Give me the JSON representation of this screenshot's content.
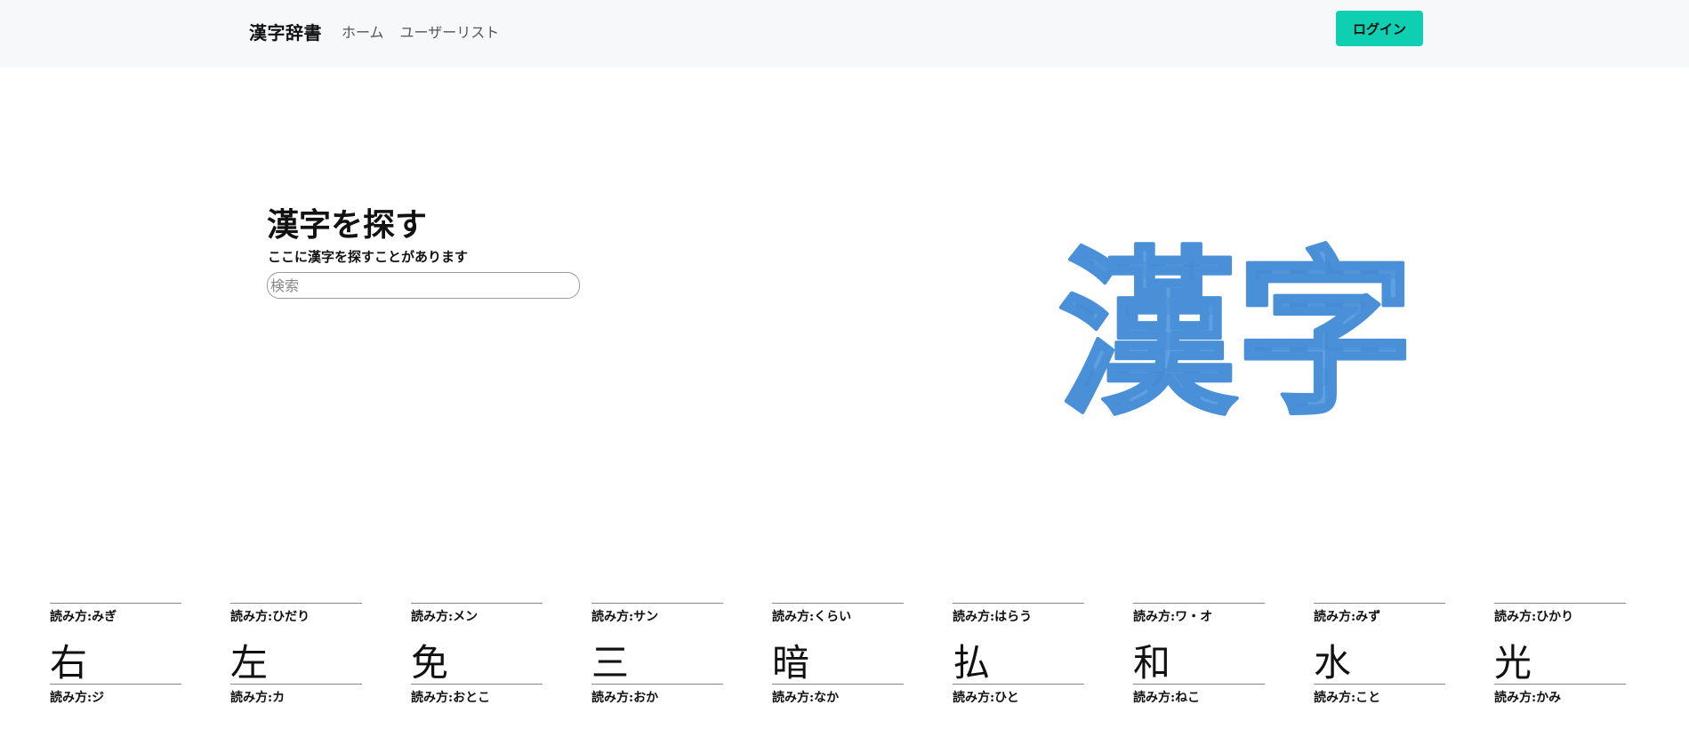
{
  "navbar": {
    "brand": "漢字辞書",
    "links": [
      "ホーム",
      "ユーザーリスト"
    ],
    "login_label": "ログイン"
  },
  "hero": {
    "title": "漢字を探す",
    "subtitle": "ここに漢字を探すことがあります",
    "search_placeholder": "検索",
    "image_text": "漢字"
  },
  "cards": [
    {
      "reading_top": "読み方:みぎ",
      "kanji": "右",
      "reading_bottom": "読み方:ジ"
    },
    {
      "reading_top": "読み方:ひだり",
      "kanji": "左",
      "reading_bottom": "読み方:カ"
    },
    {
      "reading_top": "読み方:メン",
      "kanji": "免",
      "reading_bottom": "読み方:おとこ"
    },
    {
      "reading_top": "読み方:サン",
      "kanji": "三",
      "reading_bottom": "読み方:おか"
    },
    {
      "reading_top": "読み方:くらい",
      "kanji": "暗",
      "reading_bottom": "読み方:なか"
    },
    {
      "reading_top": "読み方:はらう",
      "kanji": "払",
      "reading_bottom": "読み方:ひと"
    },
    {
      "reading_top": "読み方:ワ・オ",
      "kanji": "和",
      "reading_bottom": "読み方:ねこ"
    },
    {
      "reading_top": "読み方:みず",
      "kanji": "水",
      "reading_bottom": "読み方:こと"
    },
    {
      "reading_top": "読み方:ひかり",
      "kanji": "光",
      "reading_bottom": "読み方:かみ"
    }
  ],
  "colors": {
    "accent": "#0ecfb1",
    "navbar_bg": "#f7f8fa",
    "logo_blue": "#4a90d9"
  }
}
